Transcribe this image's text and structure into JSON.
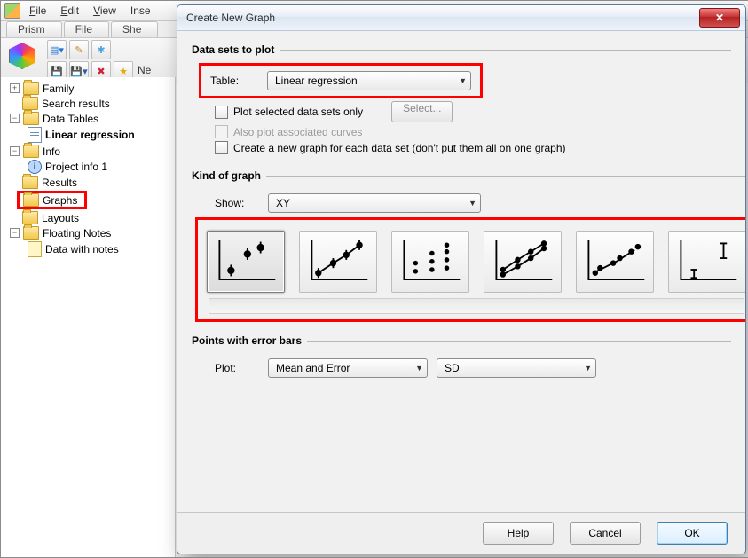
{
  "menu": {
    "file": "File",
    "edit": "Edit",
    "view": "View",
    "insert": "Inse",
    "share": "She"
  },
  "tabs": {
    "prism": "Prism",
    "file": "File"
  },
  "toolbar": {
    "newBtn": "Ne"
  },
  "tree": {
    "family": "Family",
    "search": "Search results",
    "dataTables": "Data Tables",
    "linreg": "Linear regression",
    "info": "Info",
    "projectInfo": "Project info 1",
    "results": "Results",
    "graphs": "Graphs",
    "layouts": "Layouts",
    "floating": "Floating Notes",
    "dataNotes": "Data with notes"
  },
  "dlg": {
    "title": "Create New Graph",
    "datasets_legend": "Data sets to plot",
    "table_label": "Table:",
    "table_value": "Linear regression",
    "plot_selected": "Plot selected data sets only",
    "select_btn": "Select...",
    "also_plot": "Also plot associated curves",
    "create_new": "Create a new graph for each data set (don't put them all on one graph)",
    "kind_legend": "Kind of graph",
    "show_label": "Show:",
    "show_value": "XY",
    "points_legend": "Points with error bars",
    "plot_label": "Plot:",
    "plot_value": "Mean and Error",
    "err_value": "SD",
    "help": "Help",
    "cancel": "Cancel",
    "ok": "OK"
  }
}
